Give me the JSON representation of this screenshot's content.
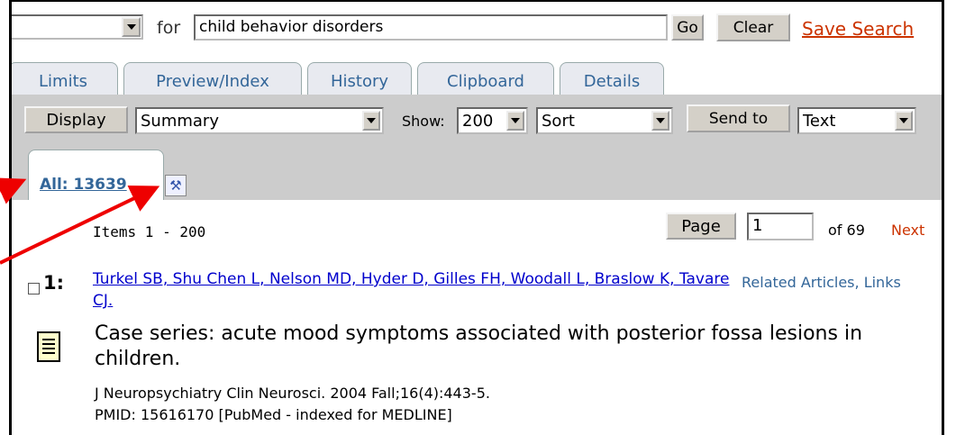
{
  "search": {
    "for_label": "for",
    "query": "child behavior disorders",
    "go_label": "Go",
    "clear_label": "Clear",
    "save_label": "Save Search"
  },
  "tabs": [
    "Limits",
    "Preview/Index",
    "History",
    "Clipboard",
    "Details"
  ],
  "display_bar": {
    "display_label": "Display",
    "format_value": "Summary",
    "show_label": "Show:",
    "show_value": "200",
    "sort_value": "Sort",
    "send_to_label": "Send to",
    "send_to_value": "Text"
  },
  "results_tab": {
    "all_label": "All: 13639",
    "tool_icon": "wrench-hammer-icon"
  },
  "paging": {
    "items_label": "Items 1 - 200",
    "page_label": "Page",
    "page_value": "1",
    "of_label": "of 69",
    "next_label": "Next"
  },
  "result": {
    "number": "1:",
    "authors": "Turkel SB, Shu Chen L, Nelson MD, Hyder D, Gilles FH, Woodall L, Braslow K, Tavare CJ.",
    "related": "Related Articles, Links",
    "title": "Case series: acute mood symptoms associated with posterior fossa lesions in children.",
    "journal": "J Neuropsychiatry Clin Neurosci. 2004 Fall;16(4):443-5.",
    "pmid": "PMID: 15616170 [PubMed - indexed for MEDLINE]"
  },
  "colors": {
    "link_orange": "#cc3300",
    "tab_blue": "#336699",
    "author_blue": "#0000cc",
    "bar_gray": "#cccccc",
    "annotation_red": "#ee0000"
  }
}
